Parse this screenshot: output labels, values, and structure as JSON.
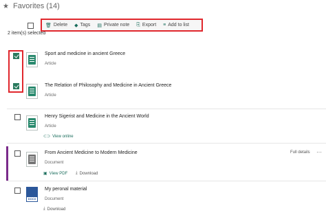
{
  "header": {
    "title": "Favorites (14)",
    "star_icon": "star-icon"
  },
  "selection": {
    "count_text": "2 item(s) selected"
  },
  "toolbar": {
    "delete_label": "Delete",
    "tags_label": "Tags",
    "private_note_label": "Private note",
    "export_label": "Export",
    "add_to_list_label": "Add to list"
  },
  "items": [
    {
      "title": "Sport and medicine in ancient Greece",
      "type": "Article",
      "checked": true
    },
    {
      "title": "The Relation of Philosophy and Medicine in Ancient Greece",
      "type": "Article",
      "checked": true
    },
    {
      "title": "Henry Sigerist and Medicine in the Ancient World",
      "type": "Article",
      "checked": false,
      "view_online_label": "View online"
    },
    {
      "title": "From Ancient Medicine to Modern Medicine",
      "type": "Document",
      "checked": false,
      "view_pdf_label": "View PDF",
      "download_label": "Download",
      "full_details_label": "Full details",
      "more_label": "···"
    },
    {
      "title": "My peronal material",
      "type": "Document",
      "checked": false,
      "download_label": "Download",
      "docx_label": "DOCX"
    }
  ],
  "colors": {
    "accent": "#2a7a5e",
    "highlight_border": "#e0262c",
    "selected_bar": "#7a2a8a"
  }
}
